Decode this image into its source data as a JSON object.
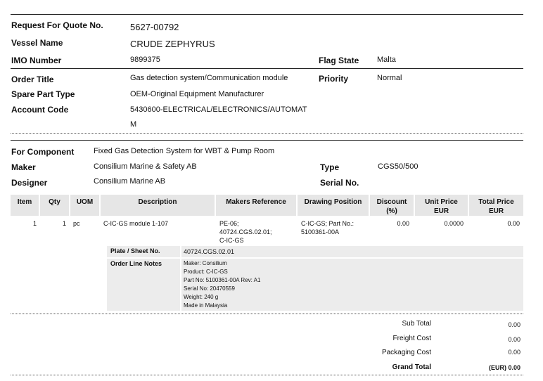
{
  "header": {
    "rfq_label": "Request For Quote No.",
    "rfq_value": "5627-00792",
    "vessel_label": "Vessel Name",
    "vessel_value": "CRUDE ZEPHYRUS",
    "imo_label": "IMO Number",
    "imo_value": "9899375",
    "flag_label": "Flag State",
    "flag_value": "Malta"
  },
  "order": {
    "title_label": "Order Title",
    "title_value": "Gas detection system/Communication module",
    "priority_label": "Priority",
    "priority_value": "Normal",
    "spare_label": "Spare Part Type",
    "spare_value": "OEM-Original Equipment Manufacturer",
    "account_label": "Account Code",
    "account_value_1": "5430600-ELECTRICAL/ELECTRONICS/AUTOMAT",
    "account_value_2": "M"
  },
  "component": {
    "for_label": "For Component",
    "for_value": "Fixed Gas Detection System for WBT & Pump Room",
    "maker_label": "Maker",
    "maker_value": "Consilium Marine & Safety AB",
    "type_label": "Type",
    "type_value": "CGS50/500",
    "designer_label": "Designer",
    "designer_value": "Consilium Marine AB",
    "serial_label": "Serial No.",
    "serial_value": ""
  },
  "table": {
    "headers": {
      "item": "Item",
      "qty": "Qty",
      "uom": "UOM",
      "description": "Description",
      "makers_ref": "Makers Reference",
      "drawing_pos": "Drawing Position",
      "discount_1": "Discount",
      "discount_2": "(%)",
      "unit_price_1": "Unit Price",
      "unit_price_2": "EUR",
      "total_price_1": "Total Price",
      "total_price_2": "EUR"
    },
    "row": {
      "item": "1",
      "qty": "1",
      "uom": "pc",
      "description": "C-IC-GS module 1-107",
      "makers_ref_1": "PE-06;",
      "makers_ref_2": "40724.CGS.02.01;",
      "makers_ref_3": "C-IC-GS",
      "drawing_pos_1": "C-IC-GS; Part No.:",
      "drawing_pos_2": "5100361-00A",
      "discount": "0.00",
      "unit_price": "0.0000",
      "total_price": "0.00"
    },
    "plate_label": "Plate / Sheet No.",
    "plate_value": "40724.CGS.02.01",
    "notes_label": "Order Line Notes",
    "notes": [
      "Maker: Consilium",
      "Product: C-IC-GS",
      "Part No: 5100361-00A Rev: A1",
      "Serial No: 20470559",
      "Weight: 240 g",
      "Made in Malaysia"
    ]
  },
  "totals": {
    "sub_label": "Sub Total",
    "sub_value": "0.00",
    "freight_label": "Freight Cost",
    "freight_value": "0.00",
    "packaging_label": "Packaging Cost",
    "packaging_value": "0.00",
    "grand_label": "Grand Total",
    "grand_value": "(EUR) 0.00"
  }
}
